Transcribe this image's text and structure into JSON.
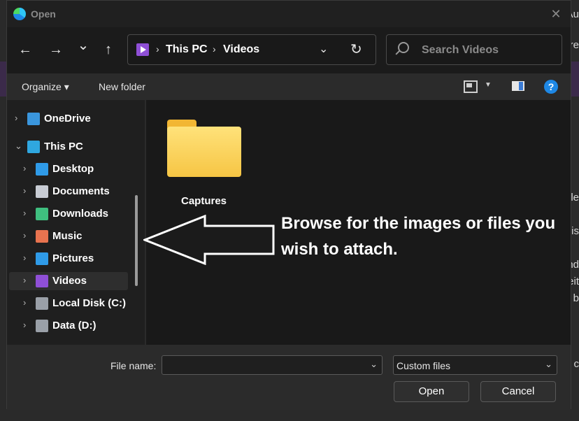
{
  "background": {
    "fragments": [
      "Au",
      "are",
      "lle",
      "is",
      "nd",
      "eit",
      "b",
      "l c"
    ]
  },
  "window": {
    "title": "Open",
    "close_glyph": "✕"
  },
  "nav": {
    "back_glyph": "←",
    "forward_glyph": "→",
    "recent_glyph": "⌄",
    "up_glyph": "↑",
    "breadcrumb": [
      "This PC",
      "Videos"
    ],
    "crumb_sep": "›",
    "dropdown_glyph": "⌄",
    "refresh_glyph": "↻",
    "search_placeholder": "Search Videos"
  },
  "toolbar": {
    "organize_label": "Organize ▾",
    "new_folder_label": "New folder",
    "view_drop_glyph": "▼",
    "help_glyph": "?"
  },
  "tree": {
    "items": [
      {
        "label": "OneDrive",
        "chevron": "›",
        "icon": "cloud-icon",
        "color": "#3a96dd"
      },
      {
        "label": "This PC",
        "chevron": "⌄",
        "icon": "monitor-icon",
        "color": "#2fa7e0"
      },
      {
        "label": "Desktop",
        "chevron": "›",
        "icon": "desktop-icon",
        "color": "#2f9be8"
      },
      {
        "label": "Documents",
        "chevron": "›",
        "icon": "document-icon",
        "color": "#c8ccd4"
      },
      {
        "label": "Downloads",
        "chevron": "›",
        "icon": "download-icon",
        "color": "#3fbf7f"
      },
      {
        "label": "Music",
        "chevron": "›",
        "icon": "music-icon",
        "color": "#e8734f"
      },
      {
        "label": "Pictures",
        "chevron": "›",
        "icon": "pictures-icon",
        "color": "#2f9be8"
      },
      {
        "label": "Videos",
        "chevron": "›",
        "icon": "videos-icon",
        "color": "#8f4fd6"
      },
      {
        "label": "Local Disk (C:)",
        "chevron": "›",
        "icon": "disk-icon",
        "color": "#9aa0a8"
      },
      {
        "label": "Data (D:)",
        "chevron": "›",
        "icon": "drive-icon",
        "color": "#9aa0a8"
      }
    ]
  },
  "content": {
    "folders": [
      {
        "label": "Captures"
      }
    ],
    "callout": "Browse for the images or files you wish to attach."
  },
  "footer": {
    "filename_label": "File name:",
    "filename_value": "",
    "filename_drop_glyph": "⌄",
    "filetype_value": "Custom files",
    "filetype_drop_glyph": "⌄",
    "open_label": "Open",
    "cancel_label": "Cancel"
  },
  "colors": {
    "accent": "#1e88e5",
    "folder": "#f6c544",
    "videos": "#8f4fd6"
  }
}
